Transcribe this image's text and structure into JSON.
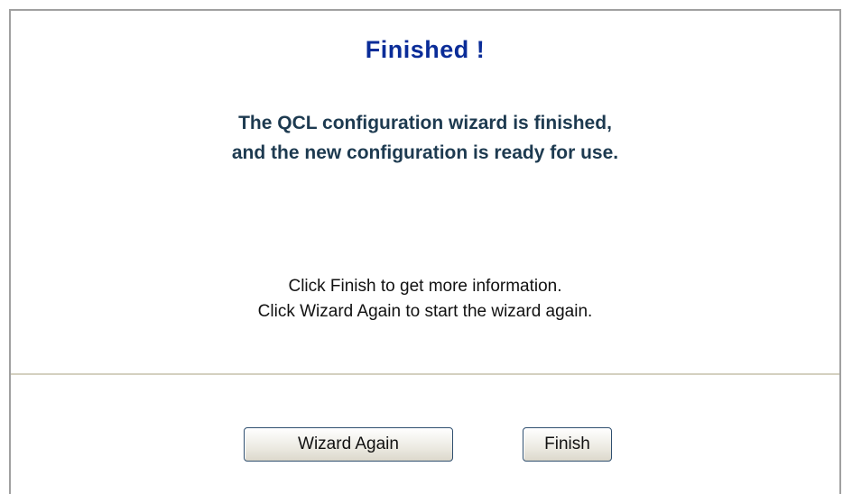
{
  "wizard": {
    "title": "Finished !",
    "message_line1": "The QCL configuration wizard is finished,",
    "message_line2": "and the new configuration is ready for use.",
    "hint_line1": "Click Finish to get more information.",
    "hint_line2": "Click Wizard Again to start the wizard again."
  },
  "buttons": {
    "wizard_again_label": "Wizard Again",
    "finish_label": "Finish"
  }
}
